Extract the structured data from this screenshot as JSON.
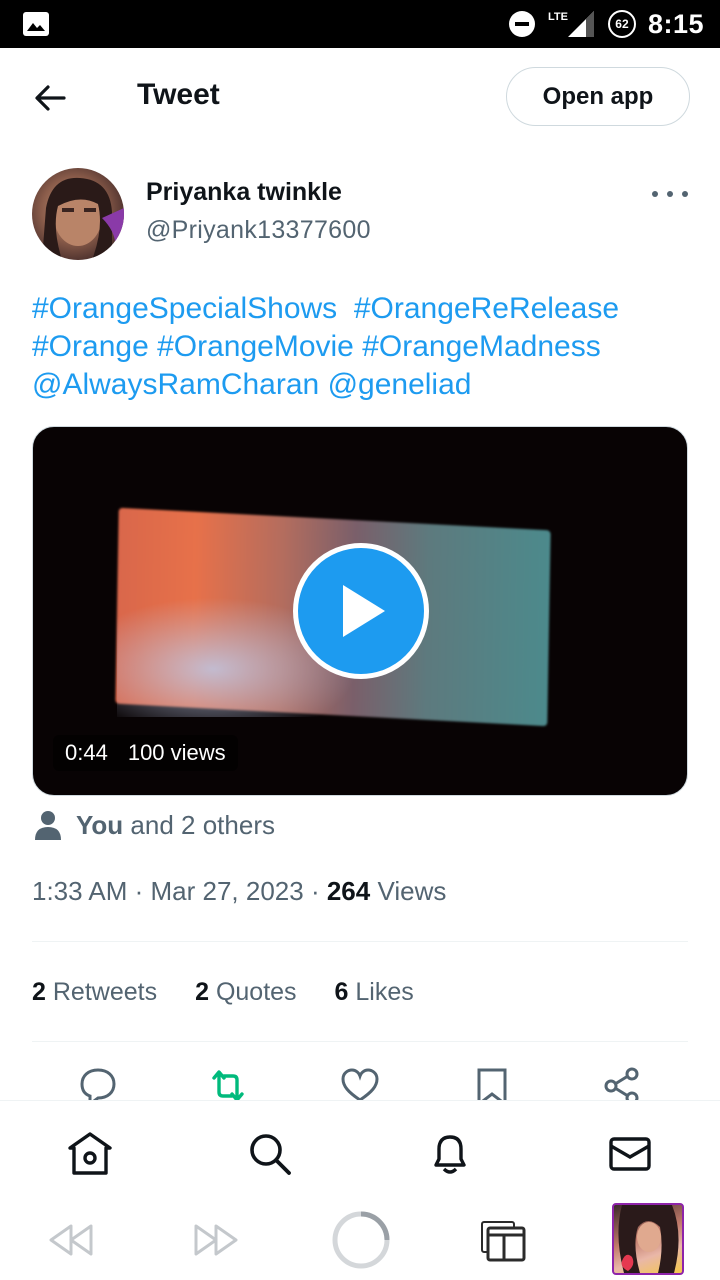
{
  "status_bar": {
    "network": "LTE",
    "battery": "62",
    "time": "8:15"
  },
  "header": {
    "title": "Tweet",
    "open_app_label": "Open app"
  },
  "author": {
    "display_name": "Priyanka twinkle",
    "handle": "@Priyank13377600"
  },
  "tweet": {
    "lines": [
      [
        "#OrangeSpecialShows",
        "#OrangeReRelease"
      ],
      [
        "#Orange",
        "#OrangeMovie",
        "#OrangeMadness"
      ],
      [
        "@AlwaysRamCharan",
        "@geneliad"
      ]
    ]
  },
  "video": {
    "duration": "0:44",
    "views": "100 views"
  },
  "liked_by": {
    "you": "You",
    "rest": "and 2 others"
  },
  "meta": {
    "time": "1:33 AM",
    "date": "Mar 27, 2023",
    "views_count": "264",
    "views_label": "Views"
  },
  "stats": {
    "retweets_count": "2",
    "retweets_label": "Retweets",
    "quotes_count": "2",
    "quotes_label": "Quotes",
    "likes_count": "6",
    "likes_label": "Likes"
  },
  "colors": {
    "accent": "#1d9bf0",
    "retweet": "#00ba7c",
    "secondary_text": "#536471"
  },
  "actions": [
    "reply-icon",
    "retweet-icon",
    "like-icon",
    "bookmark-icon",
    "share-icon"
  ],
  "nav": [
    "home-icon",
    "search-icon",
    "notifications-icon",
    "messages-icon"
  ],
  "browser": [
    "back-icon",
    "forward-icon",
    "loading-icon",
    "tabs-icon",
    "profile-thumbnail"
  ]
}
